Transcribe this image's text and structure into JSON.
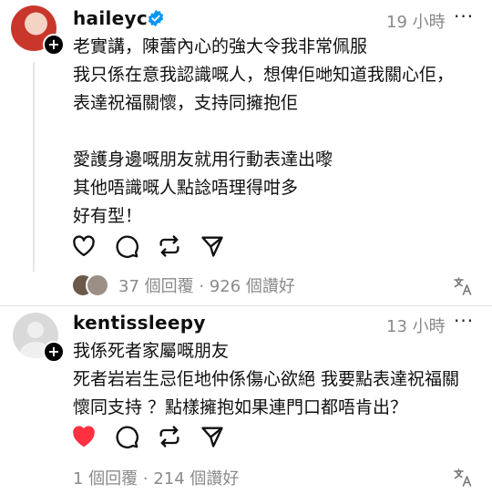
{
  "posts": [
    {
      "username": "haileyc",
      "verified": true,
      "time": "19 小時",
      "more": "···",
      "lines": [
        "老實講，陳蕾內心的強大令我非常佩服",
        "我只係在意我認識嘅人，想俾佢哋知道我關心佢，",
        "表達祝福關懷，支持同擁抱佢",
        "",
        "愛護身邊嘅朋友就用行動表達出嚟",
        "其他唔識嘅人點諗唔理得咁多",
        "好有型！"
      ],
      "stats": "37 個回覆 · 926 個讚好",
      "liked": false
    },
    {
      "username": "kentissleepy",
      "verified": false,
      "time": "13 小時",
      "more": "···",
      "lines": [
        "我係死者家屬嘅朋友",
        "死者岩岩生忌佢地仲係傷心欲絕 我要點表達祝福關",
        "懷同支持 ？點樣擁抱如果連門口都唔肯出？"
      ],
      "stats": "1 個回覆 · 214 個讚好",
      "liked": true
    }
  ],
  "icons": {
    "like": "heart-icon",
    "comment": "comment-icon",
    "repost": "repost-icon",
    "share": "send-icon",
    "translate": "translate-icon",
    "verified": "verified-badge-icon",
    "follow": "plus-icon"
  },
  "colors": {
    "liked_heart": "#ff3040",
    "verified_blue": "#0095f6",
    "muted_text": "#8a8a8a"
  }
}
